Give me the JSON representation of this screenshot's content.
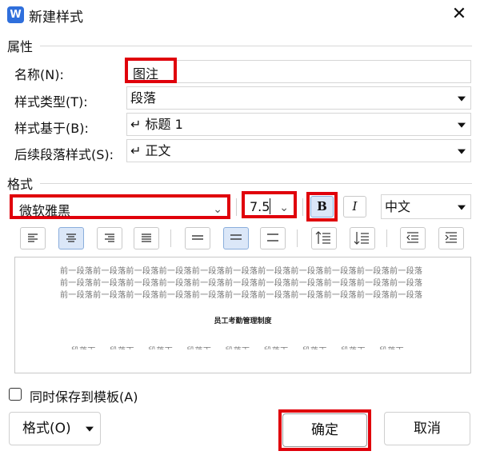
{
  "window": {
    "title": "新建样式",
    "app_icon_letter": "W"
  },
  "properties": {
    "heading": "属性",
    "name_label": "名称(N):",
    "name_value": "图注",
    "style_type_label": "样式类型(T):",
    "style_type_value": "段落",
    "based_on_label": "样式基于(B):",
    "based_on_value": "↵ 标题 1",
    "next_style_label": "后续段落样式(S):",
    "next_style_value": "↵ 正文"
  },
  "format": {
    "heading": "格式",
    "font": "微软雅黑",
    "size": "7.5",
    "bold_label": "B",
    "italic_label": "I",
    "script": "中文"
  },
  "preview": {
    "prev_paragraph_lines": [
      "前一段落前一段落前一段落前一段落前一段落前一段落前一段落前一段落前一段落前一段落前一段落",
      "前一段落前一段落前一段落前一段落前一段落前一段落前一段落前一段落前一段落前一段落前一段落",
      "前一段落前一段落前一段落前一段落前一段落前一段落前一段落前一段落前一段落前一段落前一段落"
    ],
    "sample_text": "员工考勤管理制度",
    "next_paragraph_line": "一 段落下 一 段落下 一 段落下 一 段落下 一 段落下 一 段落下 一 段落下 一 段落下 一 段落下"
  },
  "save_to_template_label": "同时保存到模板(A)",
  "buttons": {
    "format": "格式(O)",
    "ok": "确定",
    "cancel": "取消"
  }
}
